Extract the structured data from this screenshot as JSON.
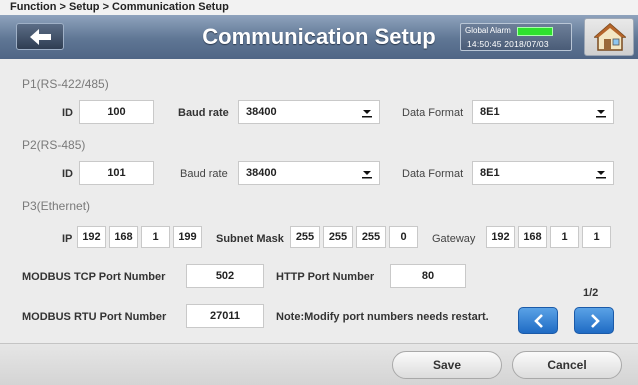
{
  "breadcrumb": "Function > Setup > Communication Setup",
  "header": {
    "title": "Communication Setup",
    "alarm_label": "Global Alarm",
    "alarm_led_color": "#2ee02e",
    "datetime": "14:50:45 2018/07/03",
    "back_icon": "back-arrow-icon",
    "home_icon": "home-icon"
  },
  "p1": {
    "title": "P1(RS-422/485)",
    "id_label": "ID",
    "id_value": "100",
    "baud_label": "Baud rate",
    "baud_value": "38400",
    "format_label": "Data Format",
    "format_value": "8E1"
  },
  "p2": {
    "title": "P2(RS-485)",
    "id_label": "ID",
    "id_value": "101",
    "baud_label": "Baud rate",
    "baud_value": "38400",
    "format_label": "Data Format",
    "format_value": "8E1"
  },
  "p3": {
    "title": "P3(Ethernet)",
    "ip_label": "IP",
    "ip": [
      "192",
      "168",
      "1",
      "199"
    ],
    "mask_label": "Subnet Mask",
    "mask": [
      "255",
      "255",
      "255",
      "0"
    ],
    "gateway_label": "Gateway",
    "gateway": [
      "192",
      "168",
      "1",
      "1"
    ]
  },
  "ports": {
    "tcp_label": "MODBUS TCP Port Number",
    "tcp_value": "502",
    "http_label": "HTTP Port Number",
    "http_value": "80",
    "rtu_label": "MODBUS RTU Port Number",
    "rtu_value": "27011",
    "note": "Note:Modify port numbers needs restart."
  },
  "pager": {
    "indicator": "1/2"
  },
  "footer": {
    "save_label": "Save",
    "cancel_label": "Cancel"
  }
}
